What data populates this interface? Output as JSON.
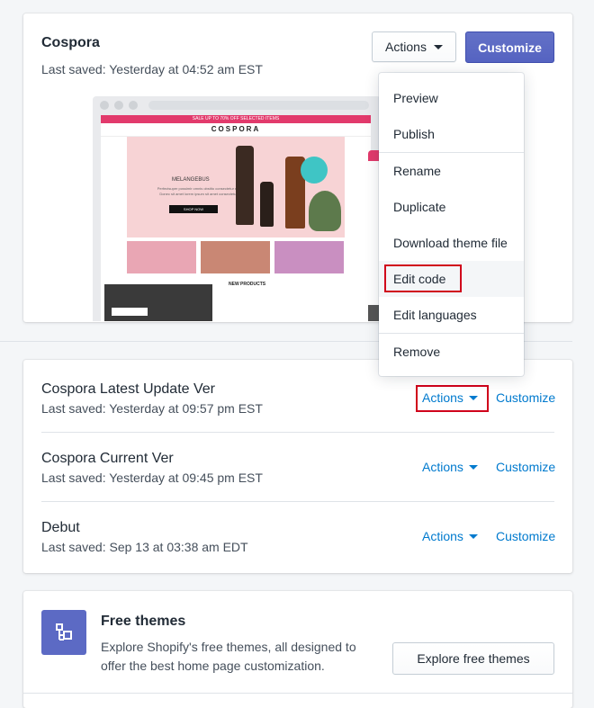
{
  "current_theme": {
    "name": "Cospora",
    "last_saved": "Last saved: Yesterday at 04:52 am EST",
    "actions_label": "Actions",
    "customize_label": "Customize",
    "preview": {
      "store_logo": "COSPORA",
      "promo_bar": "SALE UP TO 70% OFF SELECTED ITEMS",
      "hero_title": "MELANGEBUS",
      "hero_text": "Perfectsuper possimir omnis obstito consectetur elit. Donec sit amet lorem ipsum sit amet consectetur.",
      "hero_button": "SHOP NOW",
      "section_title": "NEW PRODUCTS"
    }
  },
  "dropdown": {
    "items": [
      "Preview",
      "Publish",
      "Rename",
      "Duplicate",
      "Download theme file",
      "Edit code",
      "Edit languages",
      "Remove"
    ],
    "highlighted": "Edit code"
  },
  "library": [
    {
      "name": "Cospora Latest Update Ver",
      "last_saved": "Last saved: Yesterday at 09:57 pm EST",
      "actions_label": "Actions",
      "customize_label": "Customize",
      "highlighted": true
    },
    {
      "name": "Cospora Current Ver",
      "last_saved": "Last saved: Yesterday at 09:45 pm EST",
      "actions_label": "Actions",
      "customize_label": "Customize",
      "highlighted": false
    },
    {
      "name": "Debut",
      "last_saved": "Last saved: Sep 13 at 03:38 am EDT",
      "actions_label": "Actions",
      "customize_label": "Customize",
      "highlighted": false
    }
  ],
  "free_themes": {
    "icon": "theme-store-icon",
    "title": "Free themes",
    "description": "Explore Shopify's free themes, all designed to offer the best home page customization.",
    "button_label": "Explore free themes"
  },
  "colors": {
    "primary": "#5c6ac4",
    "link": "#007ace",
    "highlight": "#d0021b"
  }
}
